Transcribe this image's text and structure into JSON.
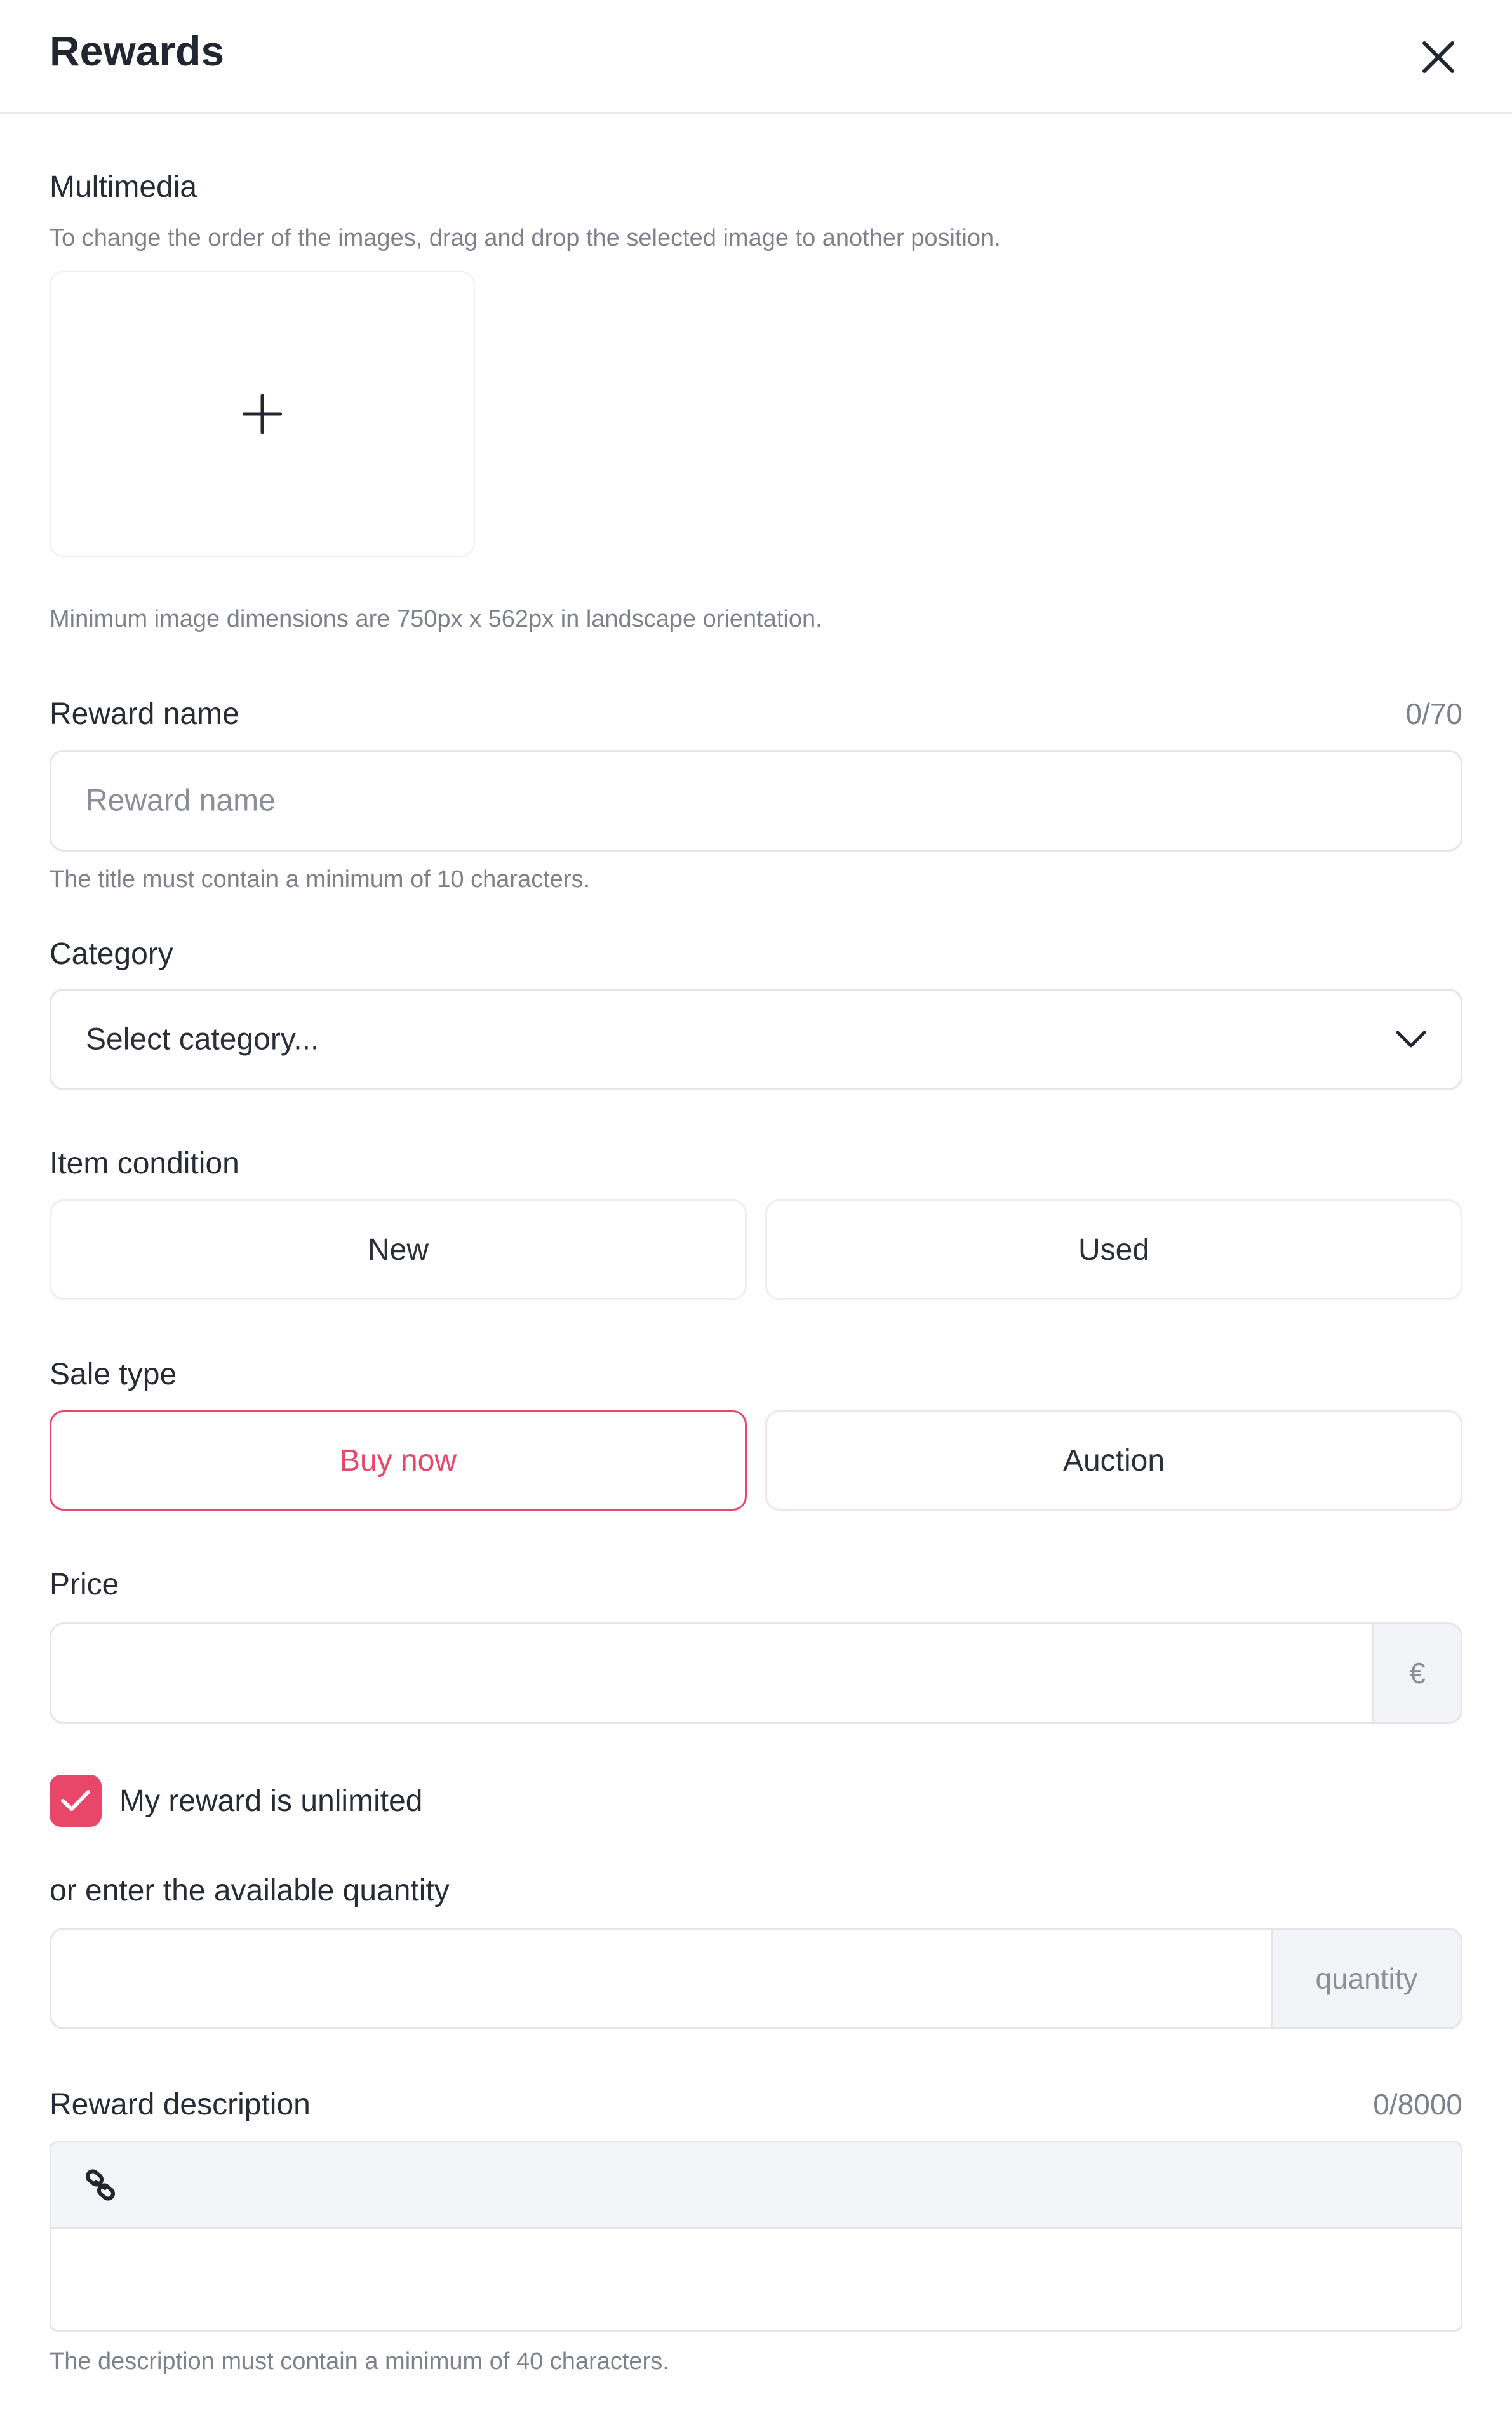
{
  "header": {
    "title": "Rewards"
  },
  "multimedia": {
    "label": "Multimedia",
    "hint": "To change the order of the images, drag and drop the selected image to another position.",
    "dimensions_hint": "Minimum image dimensions are 750px x 562px in landscape orientation."
  },
  "reward_name": {
    "label": "Reward name",
    "counter": "0/70",
    "placeholder": "Reward name",
    "hint": "The title must contain a minimum of 10 characters."
  },
  "category": {
    "label": "Category",
    "selected": "Select category..."
  },
  "item_condition": {
    "label": "Item condition",
    "options": [
      "New",
      "Used"
    ]
  },
  "sale_type": {
    "label": "Sale type",
    "options": [
      "Buy now",
      "Auction"
    ],
    "selected": "Buy now"
  },
  "price": {
    "label": "Price",
    "currency": "€"
  },
  "unlimited": {
    "label": "My reward is unlimited",
    "checked": true
  },
  "quantity": {
    "label": "or enter the available quantity",
    "addon": "quantity"
  },
  "description": {
    "label": "Reward description",
    "counter": "0/8000",
    "hint": "The description must contain a minimum of 40 characters."
  },
  "colors": {
    "accent": "#e8476a",
    "border": "#e3e5ea",
    "muted_text": "#7c818c"
  },
  "icons": [
    "close-icon",
    "plus-icon",
    "chevron-down-icon",
    "check-icon",
    "link-icon"
  ]
}
